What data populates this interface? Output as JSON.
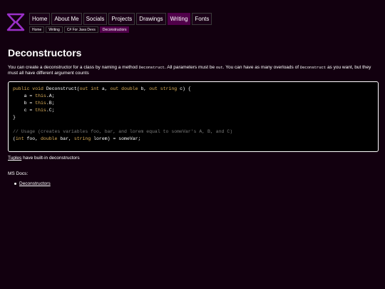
{
  "nav": {
    "items": [
      {
        "label": "Home",
        "active": false
      },
      {
        "label": "About Me",
        "active": false
      },
      {
        "label": "Socials",
        "active": false
      },
      {
        "label": "Projects",
        "active": false
      },
      {
        "label": "Drawings",
        "active": false
      },
      {
        "label": "Writing",
        "active": true
      },
      {
        "label": "Fonts",
        "active": false
      }
    ]
  },
  "breadcrumb": [
    {
      "label": "Home"
    },
    {
      "label": "Writing"
    },
    {
      "label": "C# For Java Devs"
    },
    {
      "label": "Deconstructors",
      "active": true
    }
  ],
  "page": {
    "title": "Deconstructors",
    "intro": {
      "p1": "You can create a deconstructor for a class by naming a method ",
      "c1": "Deconstruct",
      "p2": ". All parameters must be ",
      "c2": "out",
      "p3": ". You can have as many overloads of ",
      "c3": "Deconstruct",
      "p4": " as you want, but they must all have different argument counts"
    },
    "code": {
      "l1a": "public void",
      "l1b": " Deconstruct(",
      "l1c": "out int",
      "l1d": " a, ",
      "l1e": "out double",
      "l1f": " b, ",
      "l1g": "out string",
      "l1h": " c) {",
      "l2a": "    a = ",
      "l2b": "this",
      "l2c": ".A;",
      "l3a": "    b = ",
      "l3b": "this",
      "l3c": ".B;",
      "l4a": "    c = ",
      "l4b": "this",
      "l4c": ".C;",
      "l5": "}",
      "l7": "// Usage (creates variables foo, bar, and lorem equal to someVar's A, B, and C)",
      "l8a": "(",
      "l8b": "int",
      "l8c": " foo, ",
      "l8d": "double",
      "l8e": " bar, ",
      "l8f": "string",
      "l8g": " lorem) = someVar;"
    },
    "tuples_link": "Tuples",
    "tuples_text": " have built-in deconstructors",
    "msdocs_label": "MS Docs:",
    "msdocs_link": "Deconstructors"
  },
  "colors": {
    "background": "#12000f",
    "accent": "#50004a",
    "keyword": "#e0b25a",
    "comment": "#7a7a7a",
    "logo": "#9b30c8"
  },
  "icons": {
    "logo": "hourglass-sigma-logo"
  }
}
